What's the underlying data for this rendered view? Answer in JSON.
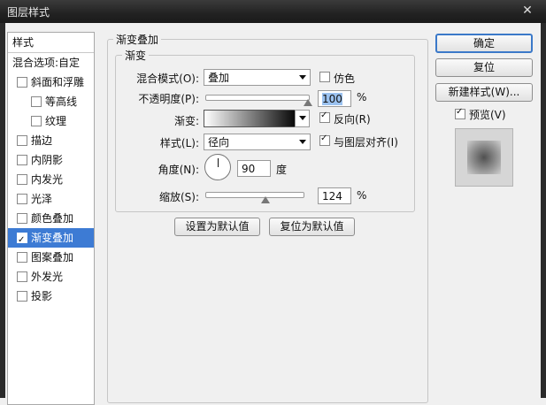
{
  "window": {
    "title": "图层样式",
    "close_glyph": "✕"
  },
  "sidebar": {
    "header": "样式",
    "items": [
      {
        "label": "混合选项:自定",
        "checkbox": false,
        "has_checkbox": false,
        "selected": false
      },
      {
        "label": "斜面和浮雕",
        "checkbox": false,
        "has_checkbox": true,
        "selected": false
      },
      {
        "label": "等高线",
        "checkbox": false,
        "has_checkbox": true,
        "selected": false,
        "indent": true
      },
      {
        "label": "纹理",
        "checkbox": false,
        "has_checkbox": true,
        "selected": false,
        "indent": true
      },
      {
        "label": "描边",
        "checkbox": false,
        "has_checkbox": true,
        "selected": false
      },
      {
        "label": "内阴影",
        "checkbox": false,
        "has_checkbox": true,
        "selected": false
      },
      {
        "label": "内发光",
        "checkbox": false,
        "has_checkbox": true,
        "selected": false
      },
      {
        "label": "光泽",
        "checkbox": false,
        "has_checkbox": true,
        "selected": false
      },
      {
        "label": "颜色叠加",
        "checkbox": false,
        "has_checkbox": true,
        "selected": false
      },
      {
        "label": "渐变叠加",
        "checkbox": true,
        "has_checkbox": true,
        "selected": true
      },
      {
        "label": "图案叠加",
        "checkbox": false,
        "has_checkbox": true,
        "selected": false
      },
      {
        "label": "外发光",
        "checkbox": false,
        "has_checkbox": true,
        "selected": false
      },
      {
        "label": "投影",
        "checkbox": false,
        "has_checkbox": true,
        "selected": false
      }
    ]
  },
  "panel": {
    "group_title": "渐变叠加",
    "subgroup_title": "渐变",
    "blend_mode": {
      "label": "混合模式(O):",
      "value": "叠加"
    },
    "dither": {
      "label": "仿色",
      "checked": false
    },
    "opacity": {
      "label": "不透明度(P):",
      "value": "100",
      "unit": "%",
      "level": 1.0
    },
    "gradient": {
      "label": "渐变:"
    },
    "reverse": {
      "label": "反向(R)",
      "checked": true
    },
    "style": {
      "label": "样式(L):",
      "value": "径向"
    },
    "align": {
      "label": "与图层对齐(I)",
      "checked": true
    },
    "angle": {
      "label": "角度(N):",
      "value": "90",
      "unit": "度"
    },
    "scale": {
      "label": "缩放(S):",
      "value": "124",
      "unit": "%",
      "level": 0.62
    },
    "make_default": "设置为默认值",
    "reset_default": "复位为默认值"
  },
  "actions": {
    "ok": "确定",
    "reset": "复位",
    "new_style": "新建样式(W)...",
    "preview": {
      "label": "预览(V)",
      "checked": true
    }
  }
}
